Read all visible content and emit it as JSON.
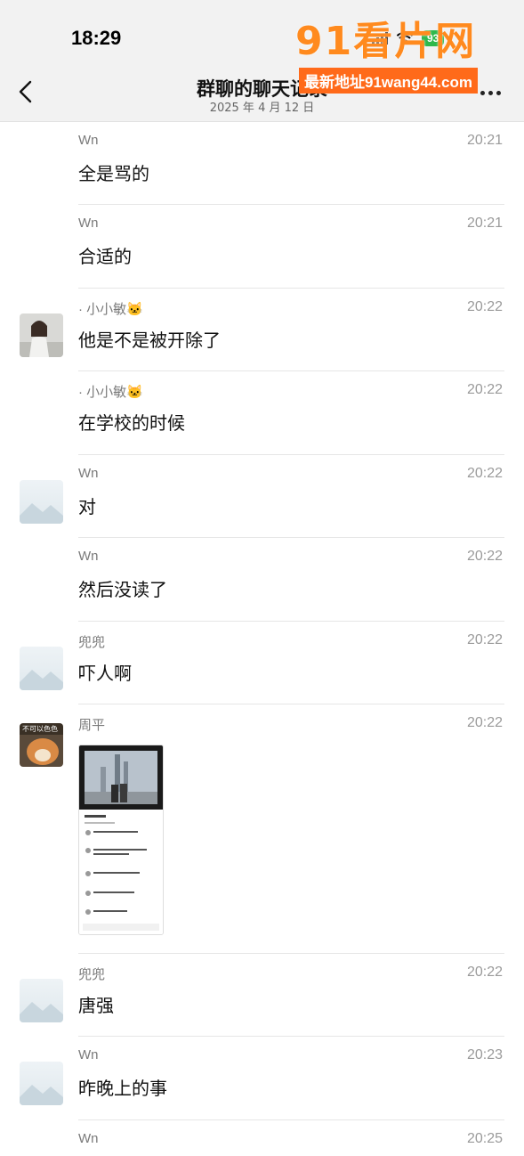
{
  "status": {
    "time": "18:29",
    "battery": "93"
  },
  "header": {
    "title": "群聊的聊天记录",
    "date": "2025 年 4 月 12 日"
  },
  "watermark": {
    "logo": "91看片网",
    "url": "最新地址91wang44.com"
  },
  "messages": [
    {
      "sender": "Wn",
      "time": "20:21",
      "text": "全是骂的",
      "avatar": "none"
    },
    {
      "sender": "Wn",
      "time": "20:21",
      "text": "合适的",
      "avatar": "none"
    },
    {
      "sender": "· 小小敏🐱",
      "time": "20:22",
      "text": "他是不是被开除了",
      "avatar": "photo-girl"
    },
    {
      "sender": "· 小小敏🐱",
      "time": "20:22",
      "text": "在学校的时候",
      "avatar": "none"
    },
    {
      "sender": "Wn",
      "time": "20:22",
      "text": "对",
      "avatar": "placeholder"
    },
    {
      "sender": "Wn",
      "time": "20:22",
      "text": "然后没读了",
      "avatar": "none"
    },
    {
      "sender": "兜兜",
      "time": "20:22",
      "text": "吓人啊",
      "avatar": "placeholder"
    },
    {
      "sender": "周平",
      "time": "20:22",
      "text": "",
      "avatar": "photo-dog",
      "avatar_caption": "不可以色色",
      "image": true
    },
    {
      "sender": "兜兜",
      "time": "20:22",
      "text": "唐强",
      "avatar": "placeholder"
    },
    {
      "sender": "Wn",
      "time": "20:23",
      "text": "昨晚上的事",
      "avatar": "placeholder"
    },
    {
      "sender": "Wn",
      "time": "20:25",
      "text": "",
      "avatar": "none"
    }
  ]
}
